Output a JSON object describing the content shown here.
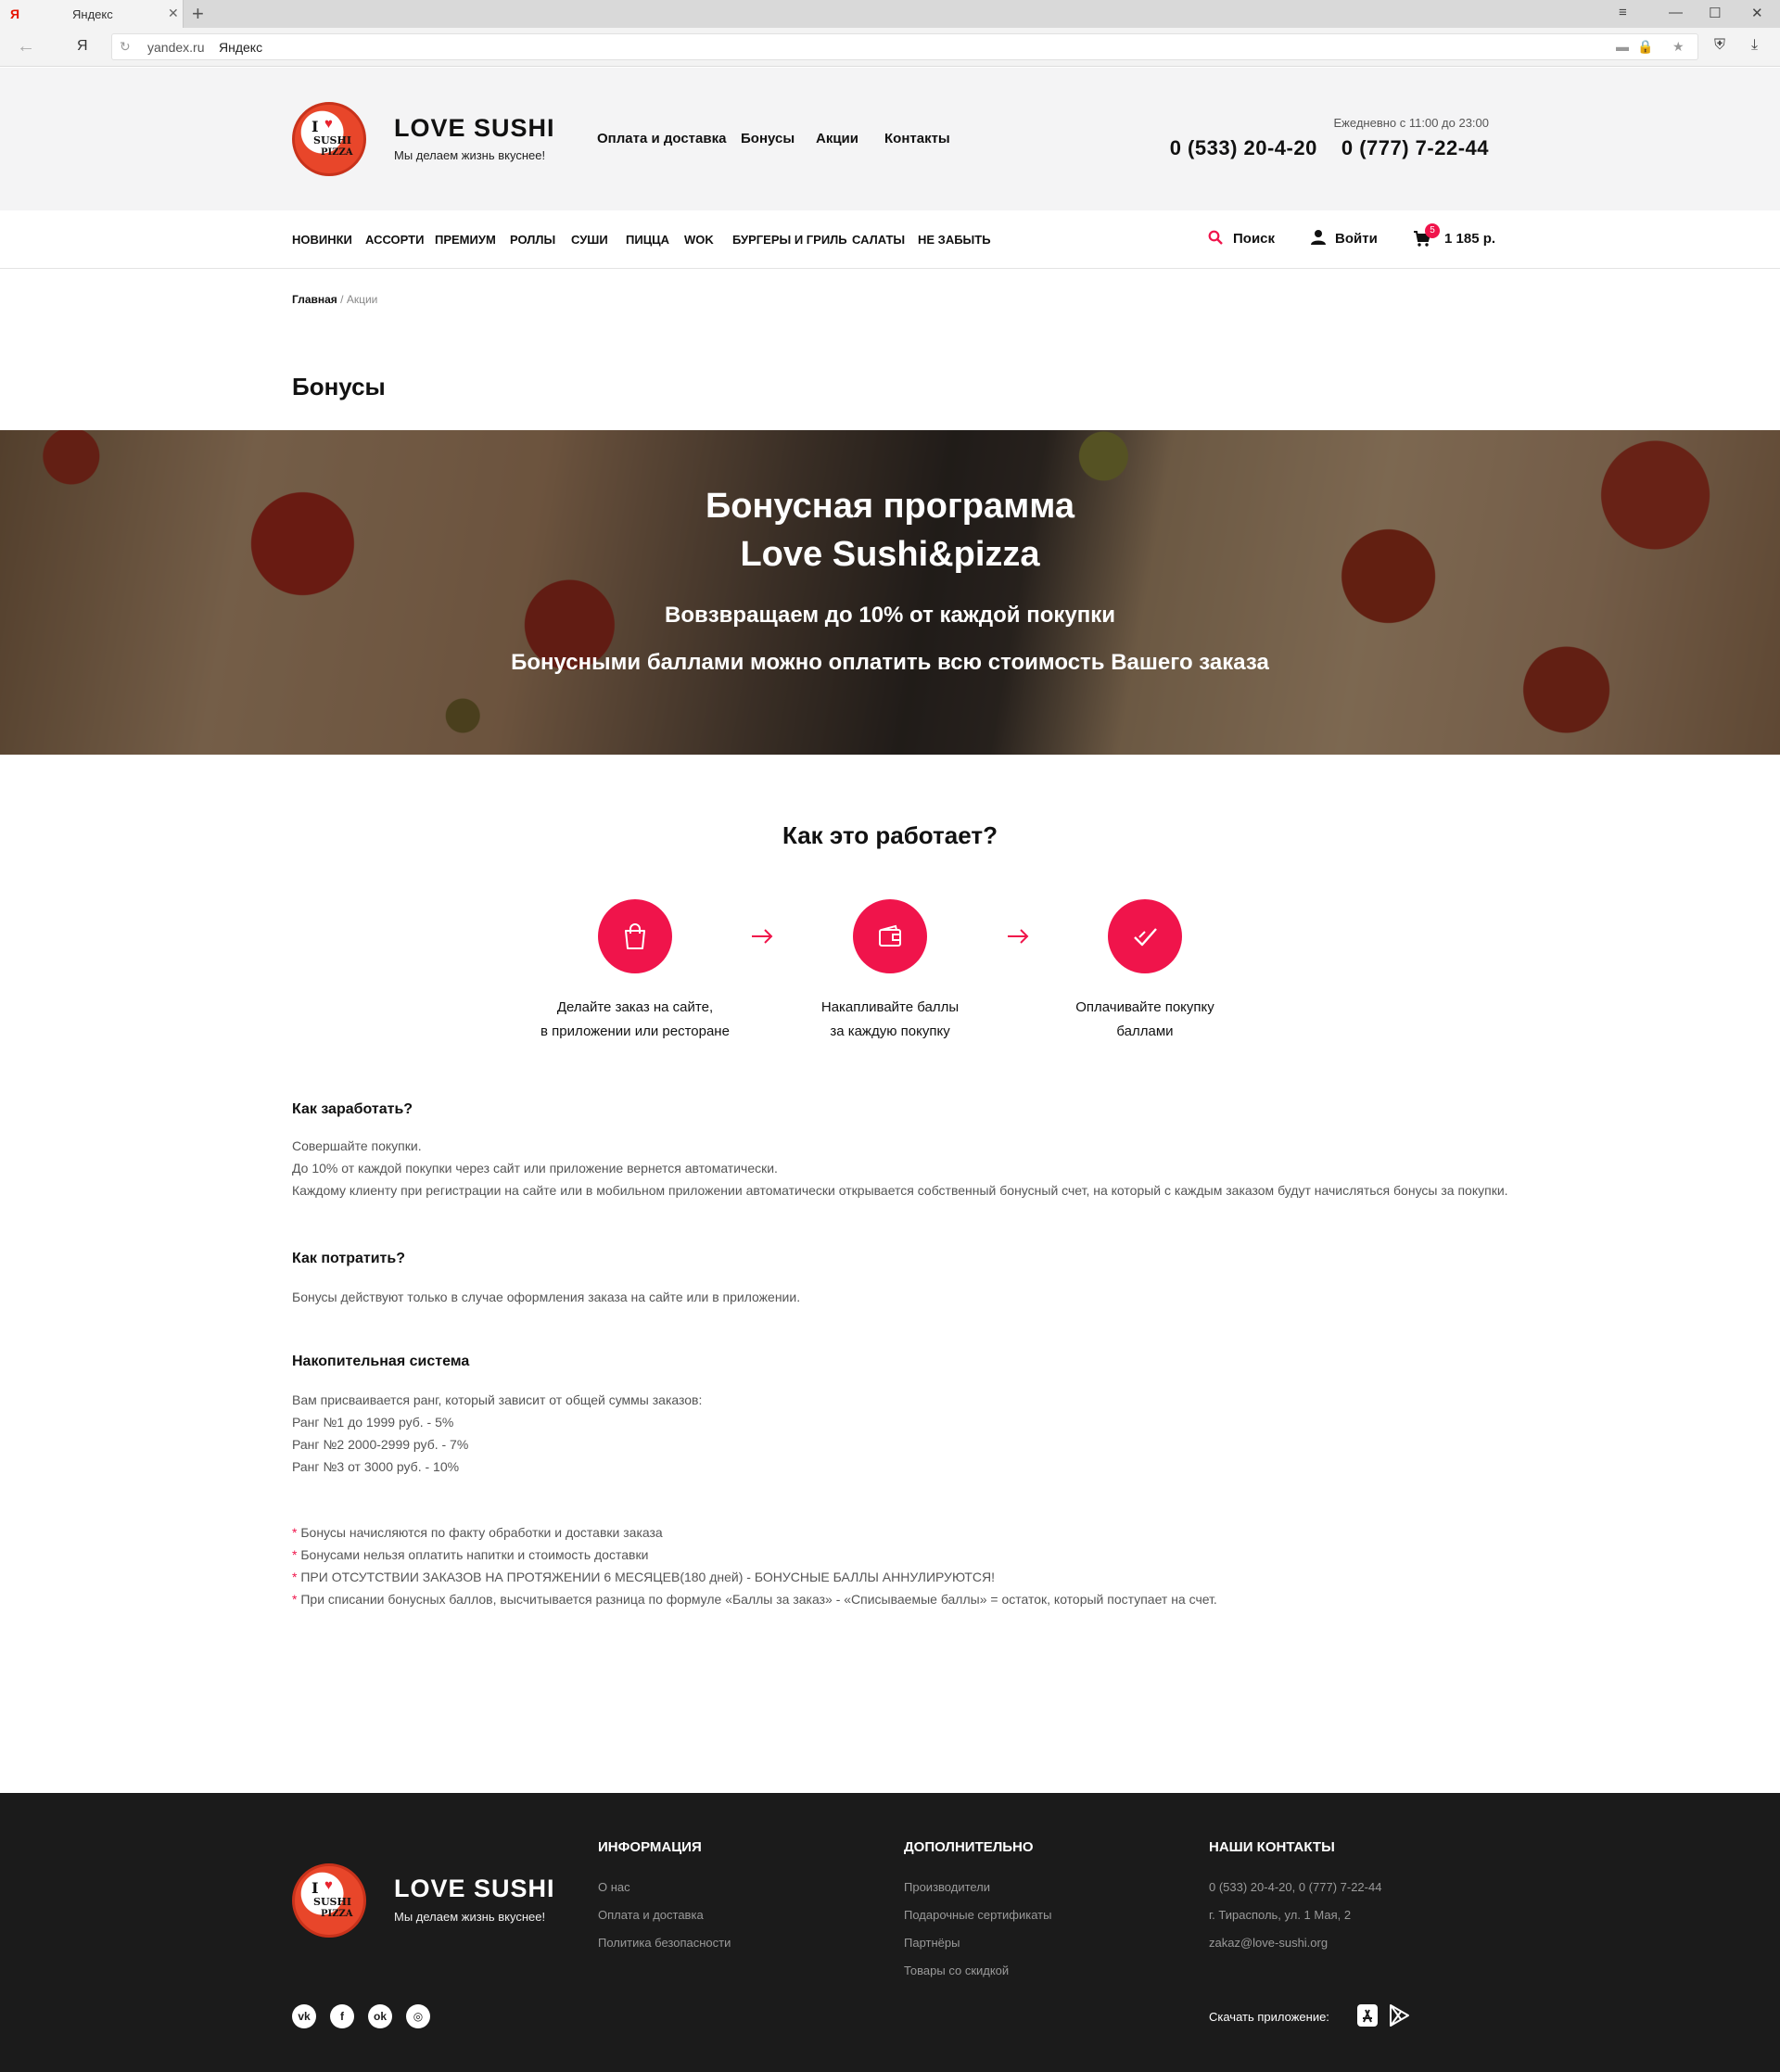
{
  "browser": {
    "tab_favicon": "Я",
    "tab_title": "Яндекс",
    "url": "yandex.ru",
    "site_name": "Яндекс",
    "ya_button": "Я"
  },
  "header": {
    "brand_name": "LOVE SUSHI",
    "tagline": "Мы делаем жизнь вкуснее!",
    "logo_text": [
      "I",
      "SUSHI",
      "PIZZA"
    ],
    "nav": [
      "Оплата и доставка",
      "Бонусы",
      "Акции",
      "Контакты"
    ],
    "hours": "Ежедневно с 11:00 до 23:00",
    "phones": [
      "0 (533) 20-4-20",
      "0 (777) 7-22-44"
    ]
  },
  "categories": [
    "НОВИНКИ",
    "АССОРТИ",
    "ПРЕМИУМ",
    "РОЛЛЫ",
    "СУШИ",
    "ПИЦЦА",
    "WOK",
    "БУРГЕРЫ И ГРИЛЬ",
    "САЛАТЫ",
    "НЕ ЗАБЫТЬ"
  ],
  "tools": {
    "search_label": "Поиск",
    "login_label": "Войти",
    "cart_count": "5",
    "cart_total": "1 185 р."
  },
  "breadcrumb": {
    "home": "Главная",
    "separator": "/",
    "current": "Акции"
  },
  "page_title": "Бонусы",
  "hero": {
    "title_line1": "Бонусная программа",
    "title_line2": "Love Sushi&pizza",
    "subtitle1": "Вовзвращаем до 10% от каждой покупки",
    "subtitle2": "Бонусными баллами можно оплатить всю стоимость Вашего заказа"
  },
  "how": {
    "title": "Как это работает?",
    "steps": [
      {
        "icon": "shopping-bag-icon",
        "line1": "Делайте заказ на сайте,",
        "line2": "в приложении или ресторане"
      },
      {
        "icon": "wallet-icon",
        "line1": "Накапливайте баллы",
        "line2": "за каждую покупку"
      },
      {
        "icon": "checkmark-icon",
        "line1": "Оплачивайте покупку",
        "line2": "баллами"
      }
    ]
  },
  "sections": {
    "earn": {
      "heading": "Как заработать?",
      "lines": [
        "Совершайте покупки.",
        "До 10% от каждой покупки через сайт или приложение вернется автоматически.",
        "Каждому клиенту при регистрации на сайте или в мобильном приложении автоматически открывается собственный бонусный счет, на который с каждым заказом будут начисляться бонусы за покупки."
      ]
    },
    "spend": {
      "heading": "Как потратить?",
      "lines": [
        "Бонусы действуют только в случае оформления заказа на сайте или в приложении."
      ]
    },
    "accum": {
      "heading": "Накопительная система",
      "lines": [
        "Вам присваивается ранг, который зависит от общей суммы заказов:",
        "Ранг №1 до 1999 руб. - 5%",
        "Ранг №2 2000-2999 руб. - 7%",
        "Ранг №3 от 3000 руб. - 10%"
      ]
    },
    "notes": [
      "Бонусы начисляются по факту обработки и доставки заказа",
      "Бонусами нельзя оплатить напитки и стоимость доставки",
      "ПРИ ОТСУТСТВИИ ЗАКАЗОВ НА ПРОТЯЖЕНИИ 6 МЕСЯЦЕВ(180 дней) - БОНУСНЫЕ БАЛЛЫ АННУЛИРУЮТСЯ!",
      "При списании бонусных баллов, высчитывается разница по формуле «Баллы за заказ» - «Списываемые баллы» = остаток, который поступает на счет."
    ],
    "note_mark": "*"
  },
  "footer": {
    "brand_name": "LOVE SUSHI",
    "tagline": "Мы делаем жизнь вкуснее!",
    "info": {
      "heading": "ИНФОРМАЦИЯ",
      "items": [
        "О нас",
        "Оплата и доставка",
        "Политика безопасности"
      ]
    },
    "extra": {
      "heading": "ДОПОЛНИТЕЛЬНО",
      "items": [
        "Производители",
        "Подарочные сертификаты",
        "Партнёры",
        "Товары со скидкой"
      ]
    },
    "contacts": {
      "heading": "НАШИ КОНТАКТЫ",
      "items": [
        "0 (533) 20-4-20, 0 (777) 7-22-44",
        "г. Тирасполь, ул. 1 Мая, 2",
        "zakaz@love-sushi.org"
      ]
    },
    "social": [
      "vk-icon",
      "facebook-icon",
      "odnoklassniki-icon",
      "instagram-icon"
    ],
    "social_glyphs": [
      "vk",
      "f",
      "ok",
      "◎"
    ],
    "download_label": "Скачать приложение:"
  },
  "colors": {
    "accent": "#f0144b",
    "footer_bg": "#1b1b1b",
    "header_bg": "#f4f4f5"
  }
}
